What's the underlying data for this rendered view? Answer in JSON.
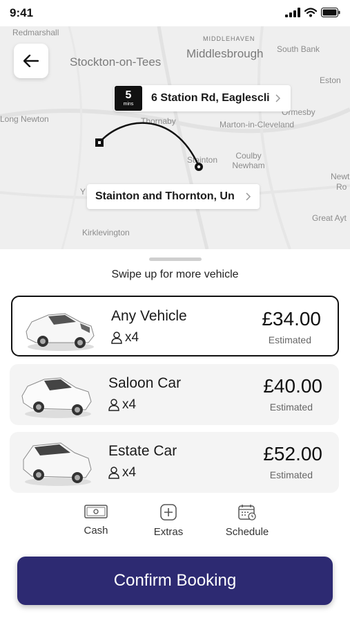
{
  "status_bar": {
    "time": "9:41"
  },
  "map": {
    "labels": {
      "redmarshall": "Redmarshall",
      "stockton": "Stockton-on-Tees",
      "middlehaven": "MIDDLEHAVEN",
      "middlesbrough": "Middlesbrough",
      "south_bank": "South Bank",
      "eston": "Eston",
      "ormesby": "Ormesby",
      "long_newton": "Long Newton",
      "thornaby": "Thornaby",
      "marton": "Marton-in-Cleveland",
      "stainton": "Stainton",
      "coulby_newham": "Coulby Newham",
      "newt": "Newt",
      "ro": "Ro",
      "great_ayt": "Great Ayt",
      "kirklevington": "Kirklevington",
      "y": "Y"
    },
    "destination": {
      "eta_value": "5",
      "eta_unit": "mins",
      "address": "6 Station Rd, Eaglescli"
    },
    "origin": {
      "address": "Stainton and Thornton, Un"
    }
  },
  "sheet": {
    "swipe_hint": "Swipe up for more vehicle",
    "vehicles": [
      {
        "name": "Any Vehicle",
        "seats": "x4",
        "price": "£34.00",
        "estimate_label": "Estimated",
        "selected": true
      },
      {
        "name": "Saloon Car",
        "seats": "x4",
        "price": "£40.00",
        "estimate_label": "Estimated",
        "selected": false
      },
      {
        "name": "Estate Car",
        "seats": "x4",
        "price": "£52.00",
        "estimate_label": "Estimated",
        "selected": false
      }
    ],
    "options": [
      {
        "label": "Cash",
        "icon": "cash-icon"
      },
      {
        "label": "Extras",
        "icon": "plus-icon"
      },
      {
        "label": "Schedule",
        "icon": "calendar-icon"
      }
    ],
    "confirm_label": "Confirm Booking"
  },
  "colors": {
    "primary": "#2d2a72",
    "map_bg": "#efefef",
    "card_bg": "#f4f4f4"
  }
}
